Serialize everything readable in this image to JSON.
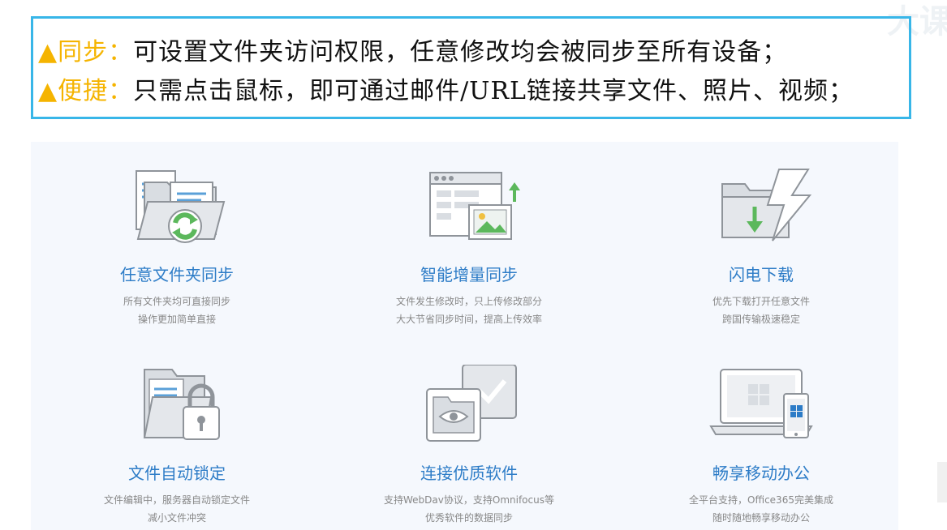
{
  "header": {
    "line1": {
      "label": "▲同步：",
      "text": "可设置文件夹访问权限，任意修改均会被同步至所有设备；"
    },
    "line2": {
      "label": "▲便捷：",
      "text": "只需点击鼠标，即可通过邮件/URL链接共享文件、照片、视频；"
    },
    "watermark": "大课"
  },
  "features": [
    {
      "icon": "folder-sync-icon",
      "title": "任意文件夹同步",
      "desc1": "所有文件夹均可直接同步",
      "desc2": "操作更加简单直接"
    },
    {
      "icon": "incremental-sync-icon",
      "title": "智能增量同步",
      "desc1": "文件发生修改时，只上传修改部分",
      "desc2": "大大节省同步时间，提高上传效率"
    },
    {
      "icon": "lightning-download-icon",
      "title": "闪电下载",
      "desc1": "优先下载打开任意文件",
      "desc2": "跨国传输极速稳定"
    },
    {
      "icon": "file-lock-icon",
      "title": "文件自动锁定",
      "desc1": "文件编辑中，服务器自动锁定文件",
      "desc2": "减小文件冲突"
    },
    {
      "icon": "connect-software-icon",
      "title": "连接优质软件",
      "desc1": "支持WebDav协议，支持Omnifocus等",
      "desc2": "优秀软件的数据同步"
    },
    {
      "icon": "mobile-office-icon",
      "title": "畅享移动办公",
      "desc1": "全平台支持，Office365完美集成",
      "desc2": "随时随地畅享移动办公"
    }
  ],
  "colors": {
    "frame": "#38b6e8",
    "label": "#f5b400",
    "title": "#2d7cc7",
    "desc": "#888888",
    "panel": "#f5f8fd",
    "icon_gray": "#8f949a",
    "icon_green": "#5cb85c"
  }
}
